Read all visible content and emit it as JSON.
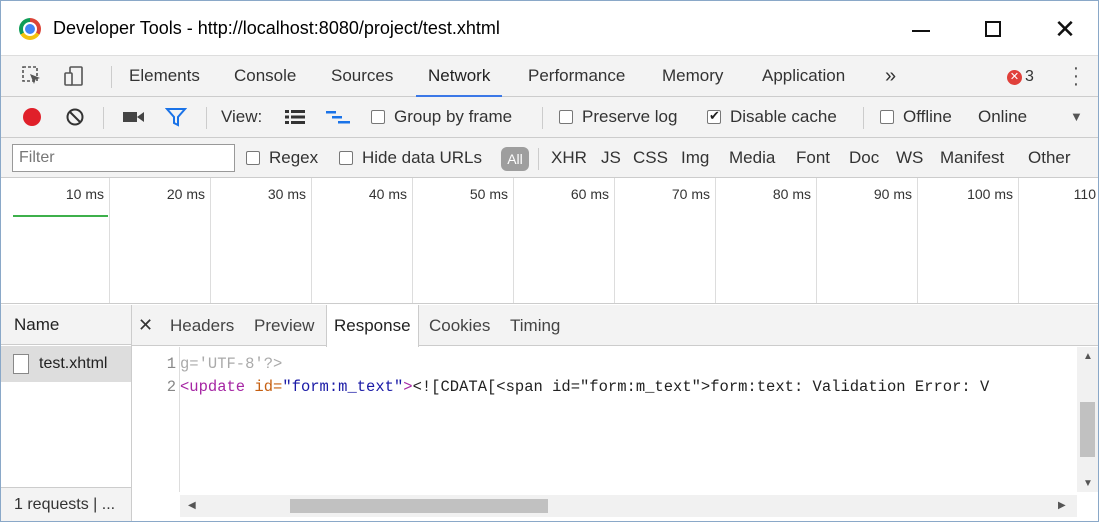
{
  "window": {
    "title": "Developer Tools - http://localhost:8080/project/test.xhtml"
  },
  "tabs": [
    {
      "label": "Elements"
    },
    {
      "label": "Console"
    },
    {
      "label": "Sources"
    },
    {
      "label": "Network"
    },
    {
      "label": "Performance"
    },
    {
      "label": "Memory"
    },
    {
      "label": "Application"
    }
  ],
  "active_tab": "Network",
  "more_tabs": "»",
  "error_count": "3",
  "toolbar": {
    "view_label": "View:",
    "group_by_frame": {
      "label": "Group by frame",
      "checked": false
    },
    "preserve_log": {
      "label": "Preserve log",
      "checked": false
    },
    "disable_cache": {
      "label": "Disable cache",
      "checked": true
    },
    "offline": {
      "label": "Offline",
      "checked": false
    },
    "throttle": "Online"
  },
  "filter": {
    "placeholder": "Filter",
    "regex": {
      "label": "Regex",
      "checked": false
    },
    "hide_data_urls": {
      "label": "Hide data URLs",
      "checked": false
    },
    "types": [
      "All",
      "XHR",
      "JS",
      "CSS",
      "Img",
      "Media",
      "Font",
      "Doc",
      "WS",
      "Manifest",
      "Other"
    ]
  },
  "timeline": {
    "ticks": [
      "10 ms",
      "20 ms",
      "30 ms",
      "40 ms",
      "50 ms",
      "60 ms",
      "70 ms",
      "80 ms",
      "90 ms",
      "100 ms",
      "110"
    ]
  },
  "requests": {
    "column_name": "Name",
    "items": [
      {
        "name": "test.xhtml"
      }
    ],
    "status": "1 requests | ..."
  },
  "detail_tabs": [
    {
      "label": "Headers"
    },
    {
      "label": "Preview"
    },
    {
      "label": "Response"
    },
    {
      "label": "Cookies"
    },
    {
      "label": "Timing"
    }
  ],
  "active_detail_tab": "Response",
  "response": {
    "line1_num": "1",
    "line1": "g='UTF-8'?>",
    "line2_num": "2",
    "line2_tag": "<update",
    "line2_attr": " id=",
    "line2_val": "\"form:m_text\"",
    "line2_close": ">",
    "line2_text": "<![CDATA[<span id=\"form:m_text\">form:text: Validation Error: V"
  }
}
